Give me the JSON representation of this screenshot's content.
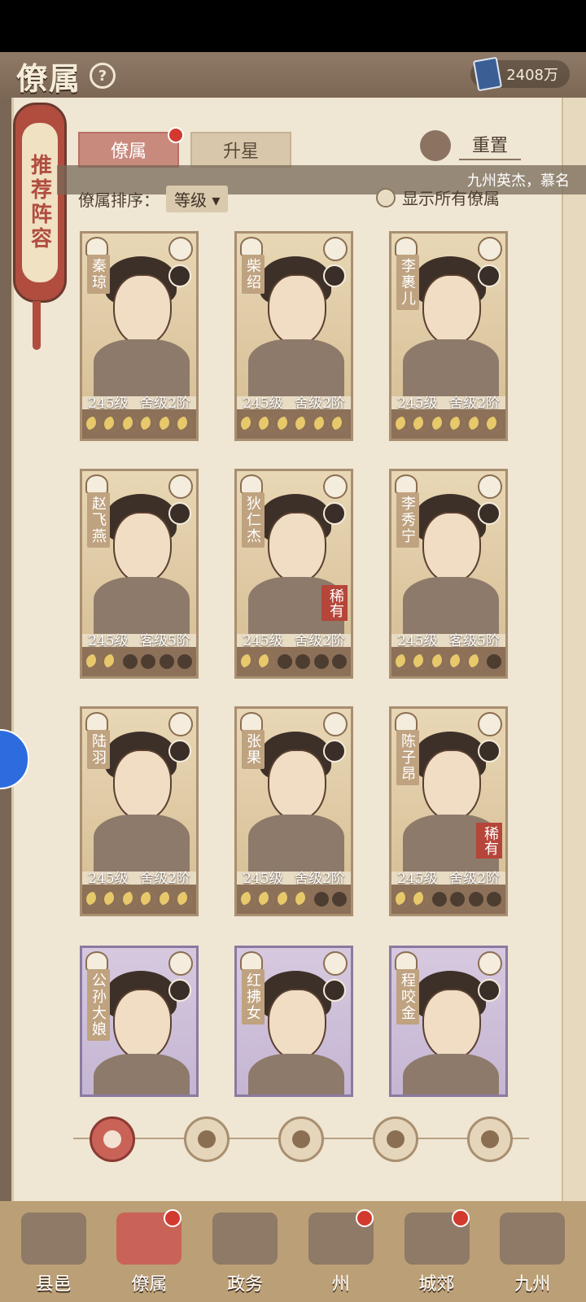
{
  "header": {
    "title": "僚属",
    "help_icon": "?",
    "currency": {
      "icon": "book-icon",
      "value": "2408万"
    }
  },
  "side_scroll": {
    "label": "推荐阵容"
  },
  "tabs": [
    {
      "label": "僚属",
      "active": true,
      "has_dot": true
    },
    {
      "label": "升星",
      "active": false,
      "has_dot": false
    }
  ],
  "reset": {
    "label": "重置"
  },
  "marquee": {
    "text": "九州英杰，慕名"
  },
  "sort": {
    "label": "僚属排序：",
    "value": "等级 ▾"
  },
  "show_all": {
    "label": "显示所有僚属",
    "checked": false
  },
  "cards": [
    {
      "name": "秦琼",
      "level": "245级",
      "rank": "舍级2阶",
      "moons_on": 6,
      "rare": "",
      "purple": false
    },
    {
      "name": "柴绍",
      "level": "245级",
      "rank": "舍级2阶",
      "moons_on": 6,
      "rare": "",
      "purple": false
    },
    {
      "name": "李裹儿",
      "level": "245级",
      "rank": "舍级2阶",
      "moons_on": 6,
      "rare": "",
      "purple": false
    },
    {
      "name": "赵飞燕",
      "level": "245级",
      "rank": "客级5阶",
      "moons_on": 2,
      "rare": "",
      "purple": false
    },
    {
      "name": "狄仁杰",
      "level": "245级",
      "rank": "舍级2阶",
      "moons_on": 2,
      "rare": "稀有",
      "purple": false
    },
    {
      "name": "李秀宁",
      "level": "245级",
      "rank": "客级5阶",
      "moons_on": 5,
      "rare": "",
      "purple": false
    },
    {
      "name": "陆羽",
      "level": "245级",
      "rank": "舍级2阶",
      "moons_on": 6,
      "rare": "",
      "purple": false
    },
    {
      "name": "张果",
      "level": "245级",
      "rank": "舍级2阶",
      "moons_on": 4,
      "rare": "",
      "purple": false
    },
    {
      "name": "陈子昂",
      "level": "245级",
      "rank": "舍级2阶",
      "moons_on": 2,
      "rare": "稀有",
      "purple": false
    },
    {
      "name": "公孙大娘",
      "level": "",
      "rank": "",
      "moons_on": 0,
      "rare": "",
      "purple": true
    },
    {
      "name": "红拂女",
      "level": "",
      "rank": "",
      "moons_on": 0,
      "rare": "",
      "purple": true
    },
    {
      "name": "程咬金",
      "level": "",
      "rank": "",
      "moons_on": 0,
      "rare": "",
      "purple": true
    }
  ],
  "filters": [
    {
      "icon": "all-icon",
      "active": true
    },
    {
      "icon": "helmet-icon",
      "active": false
    },
    {
      "icon": "cat-icon",
      "active": false
    },
    {
      "icon": "fan-icon",
      "active": false
    },
    {
      "icon": "lion-icon",
      "active": false
    }
  ],
  "bottom_nav": [
    {
      "label": "县邑",
      "active": false,
      "has_dot": false
    },
    {
      "label": "僚属",
      "active": true,
      "has_dot": true
    },
    {
      "label": "政务",
      "active": false,
      "has_dot": false
    },
    {
      "label": "州",
      "active": false,
      "has_dot": true
    },
    {
      "label": "城郊",
      "active": false,
      "has_dot": true
    },
    {
      "label": "九州",
      "active": false,
      "has_dot": false
    }
  ]
}
